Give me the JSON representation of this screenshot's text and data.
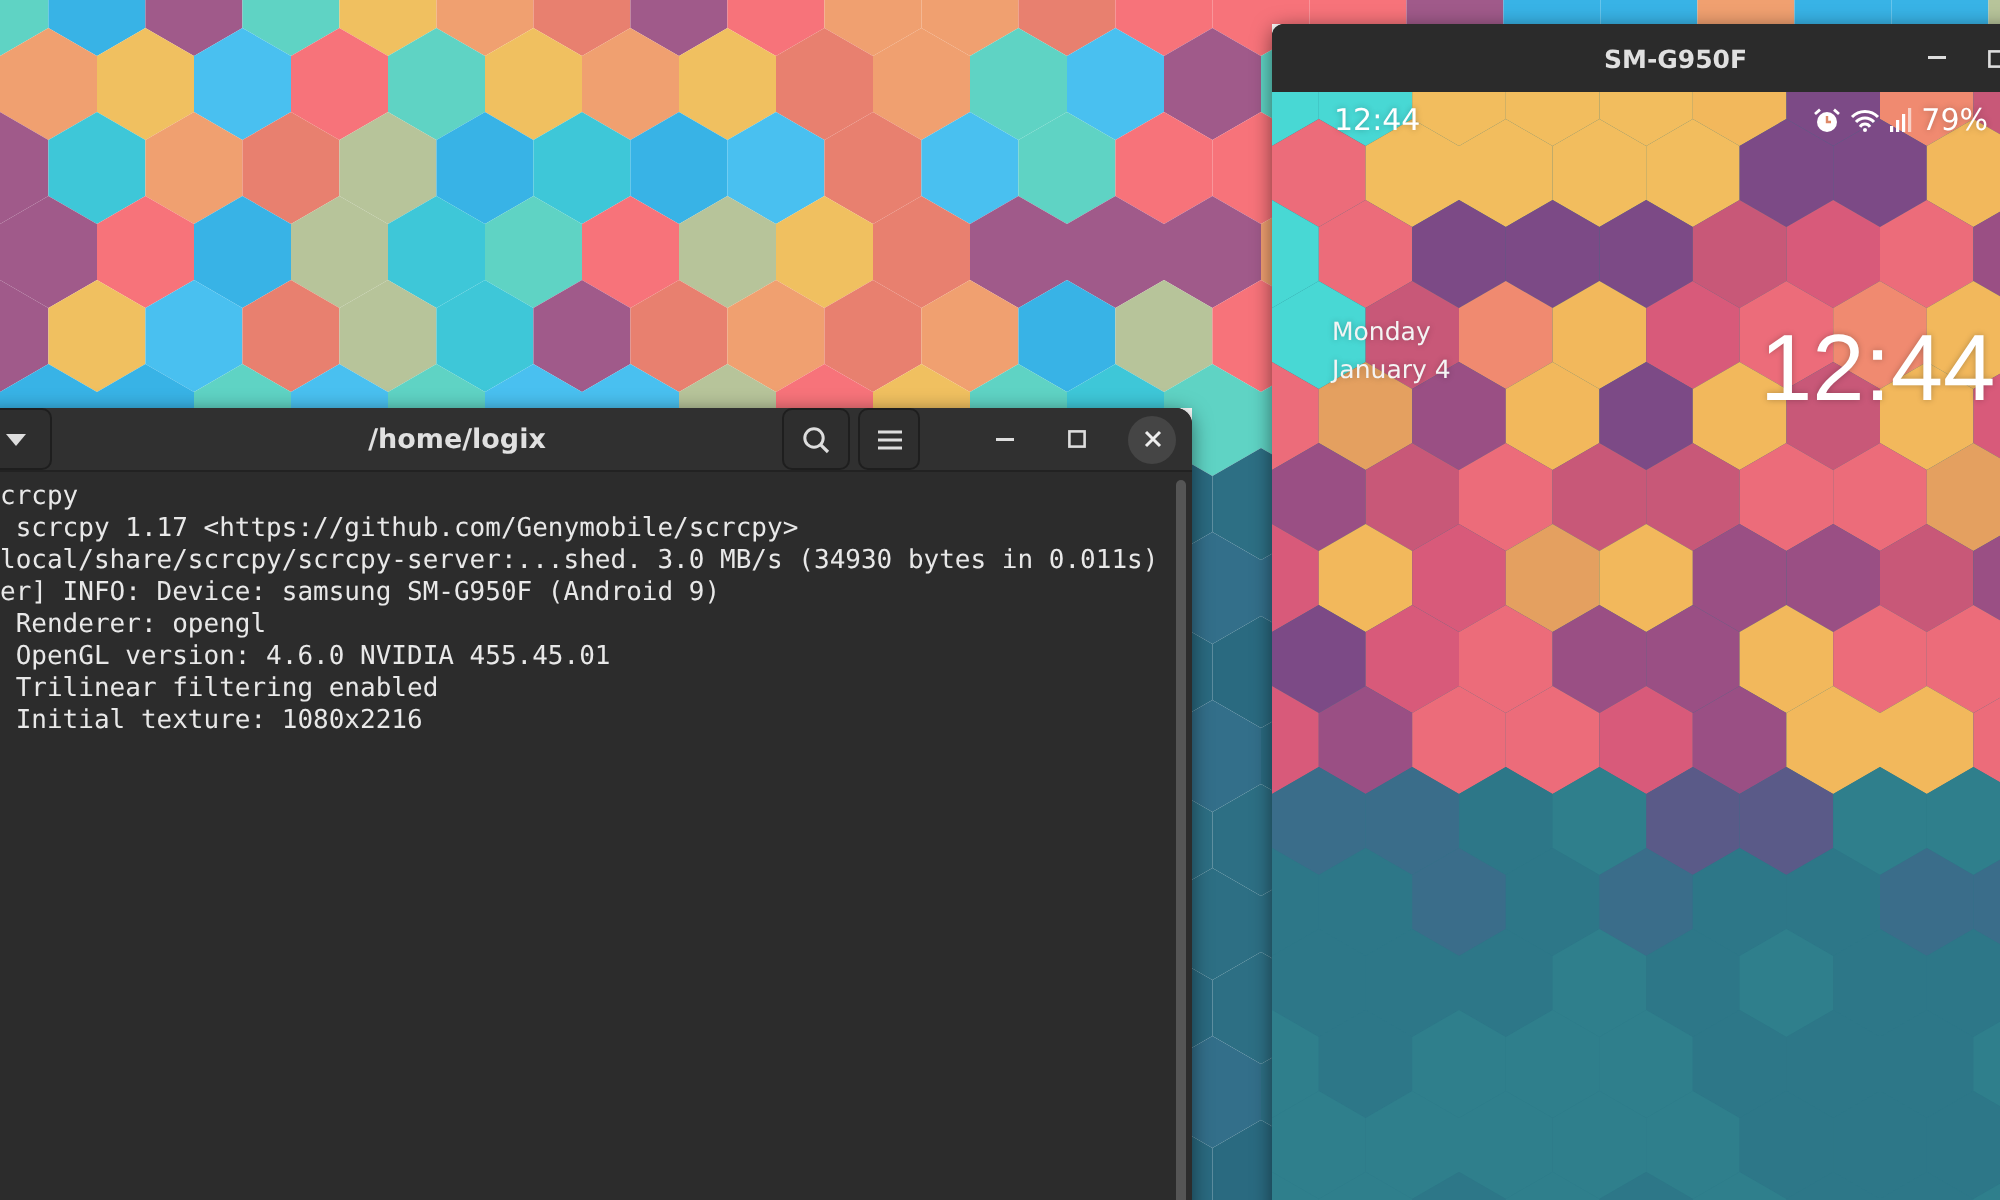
{
  "terminal": {
    "title": "/home/logix",
    "lines": [
      "crcpy",
      " scrcpy 1.17 <https://github.com/Genymobile/scrcpy>",
      "local/share/scrcpy/scrcpy-server:...shed. 3.0 MB/s (34930 bytes in 0.011s)",
      "er] INFO: Device: samsung SM-G950F (Android 9)",
      " Renderer: opengl",
      " OpenGL version: 4.6.0 NVIDIA 455.45.01",
      " Trilinear filtering enabled",
      " Initial texture: 1080x2216"
    ]
  },
  "phone_window": {
    "title": "SM-G950F",
    "status_bar": {
      "time": "12:44",
      "battery": "79%"
    },
    "lock_screen": {
      "day": "Monday",
      "date": "January 4",
      "clock": "12:44"
    }
  }
}
